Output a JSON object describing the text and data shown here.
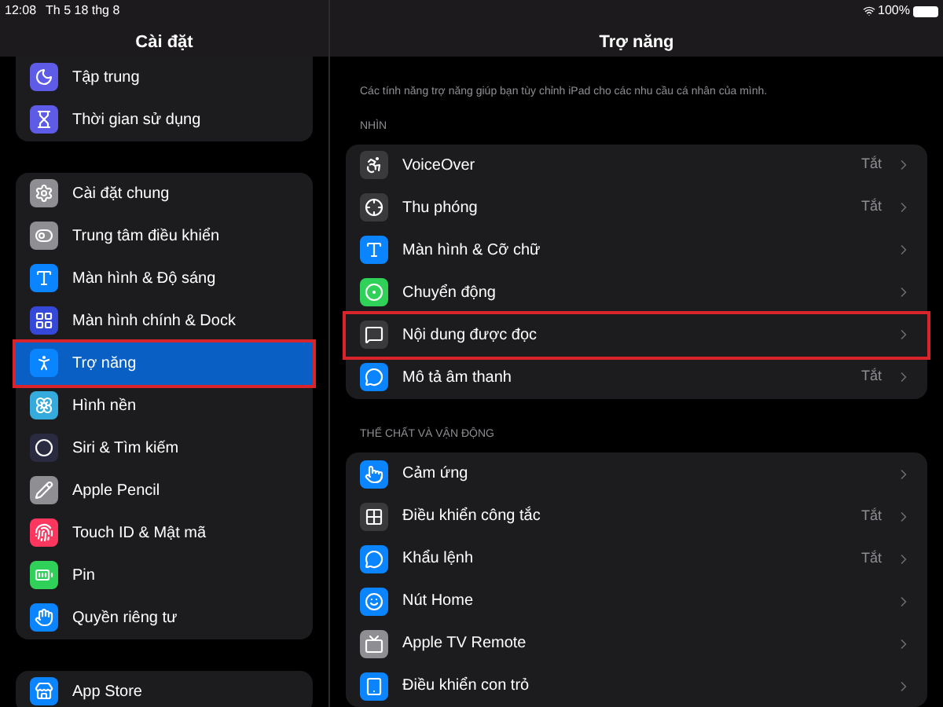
{
  "status_bar": {
    "time": "12:08",
    "date": "Th 5 18 thg 8",
    "battery": "100%"
  },
  "sidebar": {
    "title": "Cài đặt",
    "groups": [
      [
        {
          "label": "Tập trung",
          "color": "#5e5ce6",
          "selected": false,
          "highlighted": false
        },
        {
          "label": "Thời gian sử dụng",
          "color": "#5e5ce6",
          "selected": false,
          "highlighted": false
        }
      ],
      [
        {
          "label": "Cài đặt chung",
          "color": "#8e8e93",
          "selected": false,
          "highlighted": false
        },
        {
          "label": "Trung tâm điều khiển",
          "color": "#8e8e93",
          "selected": false,
          "highlighted": false
        },
        {
          "label": "Màn hình & Độ sáng",
          "color": "#0a84ff",
          "selected": false,
          "highlighted": false
        },
        {
          "label": "Màn hình chính & Dock",
          "color": "#3548d8",
          "selected": false,
          "highlighted": false
        },
        {
          "label": "Trợ năng",
          "color": "#0a84ff",
          "selected": true,
          "highlighted": true
        },
        {
          "label": "Hình nền",
          "color": "#35aadc",
          "selected": false,
          "highlighted": false
        },
        {
          "label": "Siri & Tìm kiếm",
          "color": "#2a2a40",
          "selected": false,
          "highlighted": false
        },
        {
          "label": "Apple Pencil",
          "color": "#8e8e93",
          "selected": false,
          "highlighted": false
        },
        {
          "label": "Touch ID & Mật mã",
          "color": "#ff375f",
          "selected": false,
          "highlighted": false
        },
        {
          "label": "Pin",
          "color": "#30d158",
          "selected": false,
          "highlighted": false
        },
        {
          "label": "Quyền riêng tư",
          "color": "#0a84ff",
          "selected": false,
          "highlighted": false
        }
      ],
      [
        {
          "label": "App Store",
          "color": "#0a84ff",
          "selected": false,
          "highlighted": false
        }
      ]
    ]
  },
  "detail": {
    "title": "Trợ năng",
    "description": "Các tính năng trợ năng giúp bạn tùy chỉnh iPad cho các nhu cầu cá nhân của mình.",
    "sections": [
      {
        "header": "NHÌN",
        "rows": [
          {
            "label": "VoiceOver",
            "value": "Tắt",
            "color": "#3a3a3c",
            "highlighted": false
          },
          {
            "label": "Thu phóng",
            "value": "Tắt",
            "color": "#3a3a3c",
            "highlighted": false
          },
          {
            "label": "Màn hình & Cỡ chữ",
            "color": "#0a84ff",
            "highlighted": false
          },
          {
            "label": "Chuyển động",
            "color": "#30d158",
            "highlighted": false
          },
          {
            "label": "Nội dung được đọc",
            "color": "#3a3a3c",
            "highlighted": true
          },
          {
            "label": "Mô tả âm thanh",
            "value": "Tắt",
            "color": "#0a84ff",
            "highlighted": false
          }
        ]
      },
      {
        "header": "THỂ CHẤT VÀ VẬN ĐỘNG",
        "rows": [
          {
            "label": "Cảm ứng",
            "color": "#0a84ff",
            "highlighted": false
          },
          {
            "label": "Điều khiển công tắc",
            "value": "Tắt",
            "color": "#3a3a3c",
            "highlighted": false
          },
          {
            "label": "Khẩu lệnh",
            "value": "Tắt",
            "color": "#0a84ff",
            "highlighted": false
          },
          {
            "label": "Nút Home",
            "color": "#0a84ff",
            "highlighted": false
          },
          {
            "label": "Apple TV Remote",
            "color": "#8e8e93",
            "highlighted": false
          },
          {
            "label": "Điều khiển con trỏ",
            "color": "#0a84ff",
            "highlighted": false
          }
        ]
      }
    ]
  }
}
